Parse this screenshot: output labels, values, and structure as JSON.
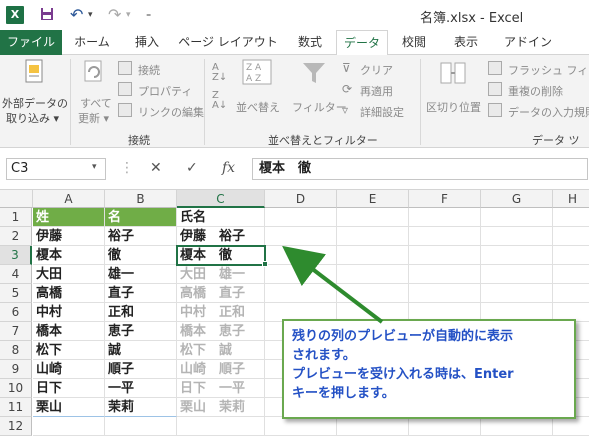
{
  "title": "名簿.xlsx - Excel",
  "qat": {
    "excel_icon": "X",
    "save_icon": "save-icon",
    "undo_icon": "↶",
    "redo_icon": "↷"
  },
  "tabs": [
    "ファイル",
    "ホーム",
    "挿入",
    "ページ レイアウト",
    "数式",
    "データ",
    "校閲",
    "表示",
    "アドイン"
  ],
  "ribbon": {
    "external_data": [
      "外部データの",
      "取り込み ▾"
    ],
    "refresh_all": [
      "すべて",
      "更新 ▾"
    ],
    "connections": "接続",
    "properties": "プロパティ",
    "edit_links": "リンクの編集",
    "group_connections": "接続",
    "sort": "並べ替え",
    "filter": "フィルター",
    "clear": "クリア",
    "reapply": "再適用",
    "advanced": "詳細設定",
    "group_sort_filter": "並べ替えとフィルター",
    "text_to_columns": "区切り位置",
    "flash_fill": "フラッシュ フィル",
    "remove_duplicates": "重複の削除",
    "data_validation": "データの入力規則",
    "group_data_tools": "データ ツー"
  },
  "formula_bar": {
    "name_box": "C3",
    "fx": "fx",
    "content": "榎本　徹"
  },
  "columns": [
    "A",
    "B",
    "C",
    "D",
    "E",
    "F",
    "G",
    "H"
  ],
  "rows": [
    "1",
    "2",
    "3",
    "4",
    "5",
    "6",
    "7",
    "8",
    "9",
    "10",
    "11",
    "12"
  ],
  "cells": {
    "a": [
      "姓",
      "伊藤",
      "榎本",
      "大田",
      "高橋",
      "中村",
      "橋本",
      "松下",
      "山崎",
      "日下",
      "栗山"
    ],
    "b": [
      "名",
      "裕子",
      "徹",
      "雄一",
      "直子",
      "正和",
      "恵子",
      "誠",
      "順子",
      "一平",
      "茉莉"
    ],
    "c": [
      "氏名",
      "伊藤　裕子",
      "榎本　徹",
      "大田　雄一",
      "高橋　直子",
      "中村　正和",
      "橋本　恵子",
      "松下　誠",
      "山崎　順子",
      "日下　一平",
      "栗山　茉莉"
    ]
  },
  "callout": {
    "line1": "残りの列のプレビューが自動的に表示",
    "line2": "されます。",
    "line3": "プレビューを受け入れる時は、Enter",
    "line4": "キーを押します。"
  },
  "colors": {
    "excel_green": "#217346",
    "header_green": "#70ad47",
    "callout_text": "#2451c5",
    "arrow": "#2e8b2e",
    "preview_gray": "#b4b4b4"
  }
}
